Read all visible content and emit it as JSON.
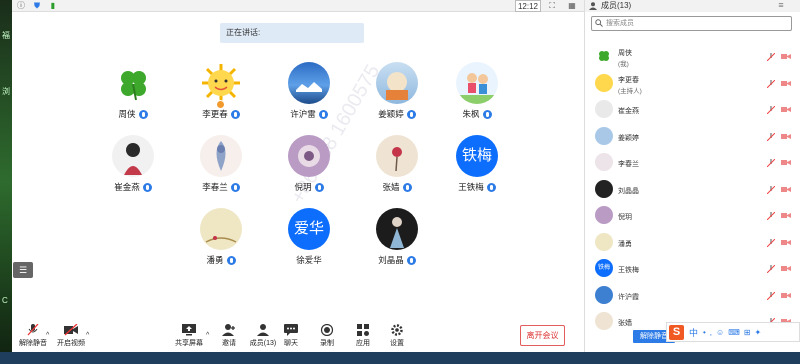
{
  "topbar": {
    "clock": "12:12"
  },
  "speaking": {
    "label": "正在讲话:"
  },
  "participants": [
    {
      "name": "周侠"
    },
    {
      "name": "李更春"
    },
    {
      "name": "许沪雷"
    },
    {
      "name": "姜颖婷"
    },
    {
      "name": "朱枫"
    },
    {
      "name": "崔金燕"
    },
    {
      "name": "李春兰"
    },
    {
      "name": "倪玥"
    },
    {
      "name": "张嫱"
    },
    {
      "name": "王铁梅",
      "avatar_text": "铁梅"
    },
    {
      "name": "潘勇"
    },
    {
      "name": "徐爱华",
      "avatar_text": "爱华"
    },
    {
      "name": "刘晶晶"
    }
  ],
  "toolbar": {
    "unmute": "解除静音",
    "start_video": "开启视频",
    "share_screen": "共享屏幕",
    "invite": "邀请",
    "members": "成员(13)",
    "chat": "聊天",
    "record": "录制",
    "apps": "应用",
    "settings": "设置",
    "leave": "离开会议"
  },
  "panel": {
    "title": "成员(13)",
    "search_placeholder": "搜索成员",
    "members": [
      {
        "name": "周侠",
        "sub": "(我)"
      },
      {
        "name": "李更春",
        "sub": "(主持人)"
      },
      {
        "name": "崔金燕"
      },
      {
        "name": "姜颖婷"
      },
      {
        "name": "李春兰"
      },
      {
        "name": "刘晶晶"
      },
      {
        "name": "倪玥"
      },
      {
        "name": "潘勇"
      },
      {
        "name": "王铁梅",
        "avatar_text": "铁梅"
      },
      {
        "name": "许沪霞"
      },
      {
        "name": "张嫱"
      }
    ],
    "unmute_all": "解除静音"
  },
  "ime": {
    "logo": "S",
    "mode": "中"
  },
  "watermark": "+86 188 1600575",
  "colors": {
    "accent": "#2d7be6",
    "leave": "#e35d5d",
    "ime": "#f05a22"
  }
}
